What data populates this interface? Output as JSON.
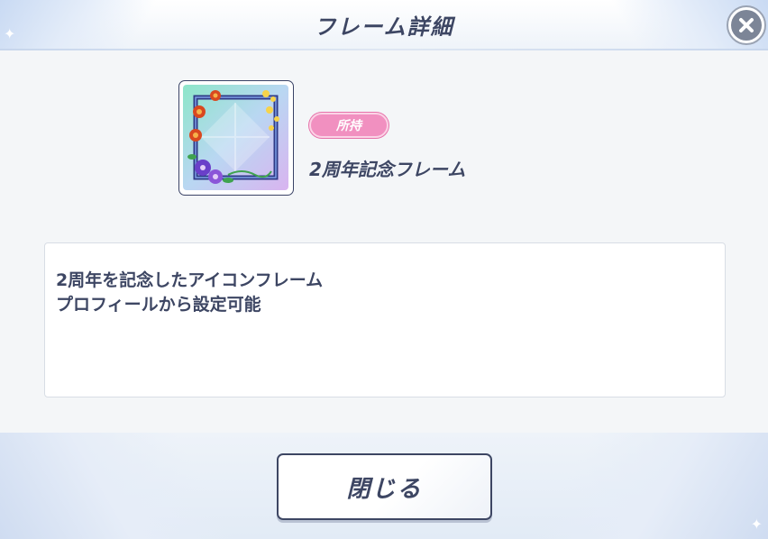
{
  "header": {
    "title": "フレーム詳細",
    "close_icon": "close-x-icon"
  },
  "frame": {
    "thumbnail_icon": "frame-thumbnail",
    "status_badge": "所持",
    "name": "2周年記念フレーム"
  },
  "description": {
    "lines": [
      "2周年を記念したアイコンフレーム",
      "プロフィールから設定可能"
    ]
  },
  "footer": {
    "close_label": "閉じる"
  },
  "colors": {
    "text": "#3d4663",
    "badge": "#f190c0",
    "accent_border": "#3d4663"
  }
}
